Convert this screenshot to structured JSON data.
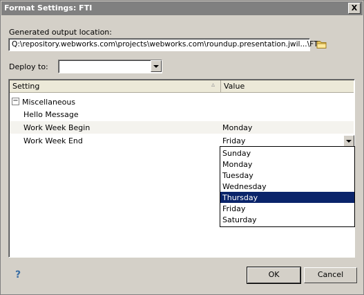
{
  "window": {
    "title": "Format Settings: FTI",
    "close_glyph": "X"
  },
  "output": {
    "label": "Generated output location:",
    "path": "Q:\\repository.webworks.com\\projects\\webworks.com\\roundup.presentation.jwil...\\FTI",
    "browse_icon": "folder-icon"
  },
  "deploy": {
    "label": "Deploy to:",
    "value": ""
  },
  "grid": {
    "headers": {
      "setting": "Setting",
      "sort_glyph": "▵",
      "value": "Value"
    },
    "group": {
      "expander": "−",
      "label": "Miscellaneous"
    },
    "rows": [
      {
        "setting": "Hello Message",
        "value": ""
      },
      {
        "setting": "Work Week Begin",
        "value": "Monday"
      },
      {
        "setting": "Work Week End",
        "value": "Friday"
      }
    ]
  },
  "dropdown": {
    "options": [
      "Sunday",
      "Monday",
      "Tuesday",
      "Wednesday",
      "Thursday",
      "Friday",
      "Saturday"
    ],
    "selected": "Thursday"
  },
  "footer": {
    "help_glyph": "?",
    "ok_label": "OK",
    "cancel_label": "Cancel"
  },
  "colors": {
    "selection": "#0a246a",
    "help": "#3a6ea5"
  }
}
